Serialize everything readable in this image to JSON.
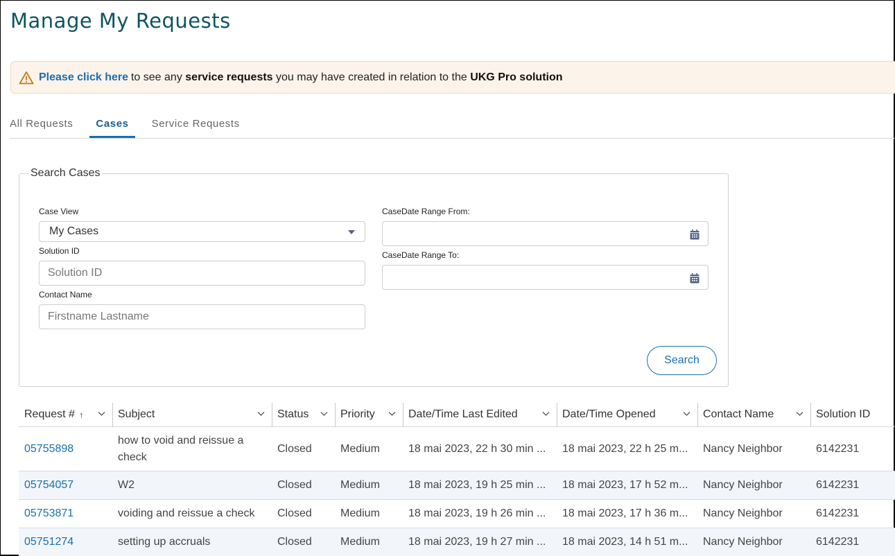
{
  "page": {
    "title": "Manage My Requests"
  },
  "notice": {
    "icon": "warning-triangle-icon",
    "link_text": "Please click here",
    "text_1": "to see any ",
    "bold_1": "service requests",
    "text_2": " you may have created in relation to the ",
    "bold_2": "UKG Pro solution"
  },
  "tabs": [
    {
      "label": "All Requests",
      "active": false
    },
    {
      "label": "Cases",
      "active": true
    },
    {
      "label": "Service Requests",
      "active": false
    }
  ],
  "search": {
    "legend": "Search Cases",
    "case_view": {
      "label": "Case View",
      "value": "My Cases"
    },
    "solution_id": {
      "label": "Solution ID",
      "value": "",
      "placeholder": "Solution ID"
    },
    "contact_name": {
      "label": "Contact Name",
      "value": "",
      "placeholder": "Firstname Lastname"
    },
    "date_from": {
      "label": "CaseDate Range From:",
      "value": "",
      "icon": "calendar-icon"
    },
    "date_to": {
      "label": "CaseDate Range To:",
      "value": "",
      "icon": "calendar-icon"
    },
    "button_label": "Search"
  },
  "table": {
    "columns": [
      {
        "label": "Request #",
        "sort": "ascending",
        "sort_glyph": "↑"
      },
      {
        "label": "Subject"
      },
      {
        "label": "Status"
      },
      {
        "label": "Priority"
      },
      {
        "label": "Date/Time Last Edited"
      },
      {
        "label": "Date/Time Opened"
      },
      {
        "label": "Contact Name"
      },
      {
        "label": "Solution ID"
      }
    ],
    "rows": [
      {
        "request": "05755898",
        "subject": "how to void and reissue a check",
        "status": "Closed",
        "priority": "Medium",
        "last_edited": "18 mai 2023, 22 h 30 min ...",
        "opened": "18 mai 2023, 22 h 25 m...",
        "contact": "Nancy Neighbor",
        "solution_id": "6142231"
      },
      {
        "request": "05754057",
        "subject": "W2",
        "status": "Closed",
        "priority": "Medium",
        "last_edited": "18 mai 2023, 19 h 25 min ...",
        "opened": "18 mai 2023, 17 h 52 m...",
        "contact": "Nancy Neighbor",
        "solution_id": "6142231"
      },
      {
        "request": "05753871",
        "subject": "voiding and reissue a check",
        "status": "Closed",
        "priority": "Medium",
        "last_edited": "18 mai 2023, 19 h 26 min ...",
        "opened": "18 mai 2023, 17 h 36 m...",
        "contact": "Nancy Neighbor",
        "solution_id": "6142231"
      },
      {
        "request": "05751274",
        "subject": "setting up accruals",
        "status": "Closed",
        "priority": "Medium",
        "last_edited": "18 mai 2023, 19 h 27 min ...",
        "opened": "18 mai 2023, 14 h 51 m...",
        "contact": "Nancy Neighbor",
        "solution_id": "6142231"
      }
    ]
  },
  "colors": {
    "title": "#0d5560",
    "accent": "#1a6fae",
    "notice_bg": "#fcf3ea",
    "warning": "#c8780e",
    "row_alt": "#f2f6fa"
  }
}
